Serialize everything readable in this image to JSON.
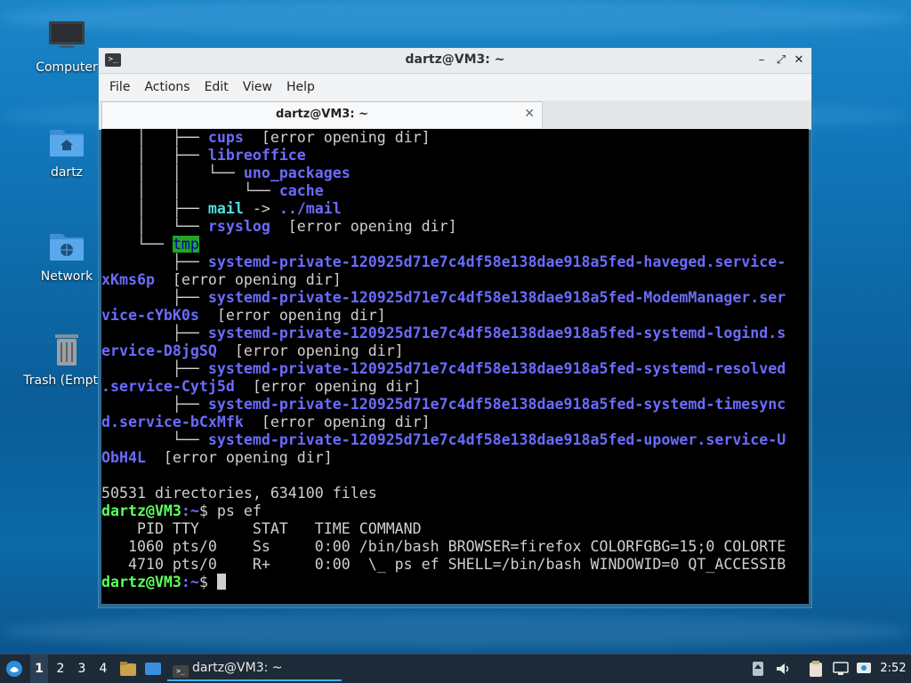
{
  "desktop": {
    "icons": [
      {
        "label": "Computer",
        "icon": "computer-icon"
      },
      {
        "label": "dartz",
        "icon": "home-folder-icon"
      },
      {
        "label": "Network",
        "icon": "network-folder-icon"
      },
      {
        "label": "Trash (Empty)",
        "icon": "trash-icon"
      }
    ]
  },
  "window": {
    "title": "dartz@VM3: ~",
    "menu": [
      "File",
      "Actions",
      "Edit",
      "View",
      "Help"
    ],
    "tab_label": "dartz@VM3: ~",
    "controls": {
      "minimize": "–",
      "maximize": "⤢",
      "close": "✕"
    }
  },
  "terminal": {
    "tree": [
      {
        "prefix": "    │   ├── ",
        "name": "cups",
        "suffix": "  [error opening dir]"
      },
      {
        "prefix": "    │   ├── ",
        "name": "libreoffice",
        "suffix": ""
      },
      {
        "prefix": "    │   │   └── ",
        "name": "uno_packages",
        "suffix": ""
      },
      {
        "prefix": "    │   │       └── ",
        "name": "cache",
        "suffix": ""
      },
      {
        "prefix": "    │   ├── ",
        "name": "mail",
        "suffix": " -> ",
        "link": "../mail"
      },
      {
        "prefix": "    │   └── ",
        "name": "rsyslog",
        "suffix": "  [error opening dir]"
      },
      {
        "prefix": "    └── ",
        "name": "tmp",
        "suffix": ""
      }
    ],
    "wrapped": [
      {
        "prefix": "        ├── ",
        "l1": "systemd-private-120925d71e7c4df58e138dae918a5fed-haveged.service-",
        "l2": "xKms6p",
        "err": "  [error opening dir]"
      },
      {
        "prefix": "        ├── ",
        "l1": "systemd-private-120925d71e7c4df58e138dae918a5fed-ModemManager.ser",
        "l2": "vice-cYbK0s",
        "err": "  [error opening dir]"
      },
      {
        "prefix": "        ├── ",
        "l1": "systemd-private-120925d71e7c4df58e138dae918a5fed-systemd-logind.s",
        "l2": "ervice-D8jgSQ",
        "err": "  [error opening dir]"
      },
      {
        "prefix": "        ├── ",
        "l1": "systemd-private-120925d71e7c4df58e138dae918a5fed-systemd-resolved",
        "l2": ".service-Cytj5d",
        "err": "  [error opening dir]"
      },
      {
        "prefix": "        ├── ",
        "l1": "systemd-private-120925d71e7c4df58e138dae918a5fed-systemd-timesync",
        "l2": "d.service-bCxMfk",
        "err": "  [error opening dir]"
      },
      {
        "prefix": "        └── ",
        "l1": "systemd-private-120925d71e7c4df58e138dae918a5fed-upower.service-U",
        "l2": "ObH4L",
        "err": "  [error opening dir]"
      }
    ],
    "summary": "50531 directories, 634100 files",
    "prompt_user": "dartz@VM3",
    "prompt_path": ":~",
    "prompt_sym": "$ ",
    "command": "ps ef",
    "ps_header": "    PID TTY      STAT   TIME COMMAND",
    "ps_rows": [
      "   1060 pts/0    Ss     0:00 /bin/bash BROWSER=firefox COLORFGBG=15;0 COLORTE",
      "   4710 pts/0    R+     0:00  \\_ ps ef SHELL=/bin/bash WINDOWID=0 QT_ACCESSIB"
    ]
  },
  "taskbar": {
    "workspaces": [
      "1",
      "2",
      "3",
      "4"
    ],
    "task_label": "dartz@VM3: ~",
    "clock": "2:52"
  }
}
